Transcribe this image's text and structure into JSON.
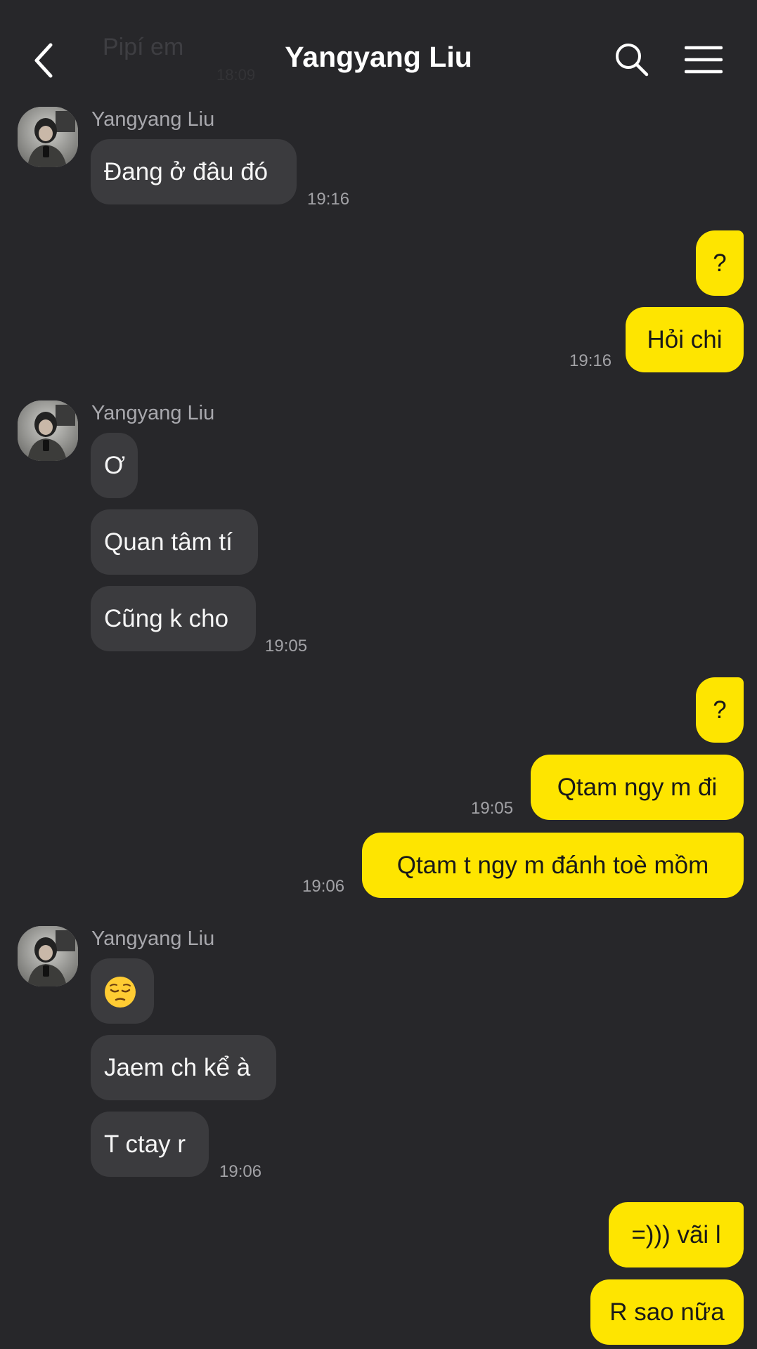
{
  "header": {
    "title": "Yangyang Liu",
    "ghost_preview": "Pipí em",
    "ghost_time": "18:09"
  },
  "groups": [
    {
      "sender": "Yangyang Liu",
      "messages": [
        "Đang ở đâu đó"
      ],
      "time": "19:16"
    },
    {
      "messages": [
        "?",
        "Hỏi chi"
      ],
      "time": "19:16"
    },
    {
      "sender": "Yangyang Liu",
      "messages": [
        "Ơ",
        "Quan tâm tí",
        "Cũng k cho"
      ],
      "time": "19:05"
    },
    {
      "messages": [
        "?",
        "Qtam ngy m đi"
      ],
      "time": "19:05"
    },
    {
      "messages": [
        "Qtam t ngy m đánh toè mồm"
      ],
      "time": "19:06"
    },
    {
      "sender": "Yangyang Liu",
      "messages": [
        "",
        "Jaem ch kể à",
        "T ctay r"
      ],
      "time": "19:06"
    },
    {
      "messages": [
        "=))) vãi l",
        "R sao nữa"
      ]
    }
  ],
  "icons": {
    "back": "chevron-left-icon",
    "search": "search-icon",
    "menu": "hamburger-menu-icon",
    "pensive_emoji": "pensive-face-emoji"
  },
  "colors": {
    "background": "#27272a",
    "incoming_bubble": "#3b3b3e",
    "outgoing_bubble": "#fee500",
    "timestamp": "#a2a2a6"
  }
}
